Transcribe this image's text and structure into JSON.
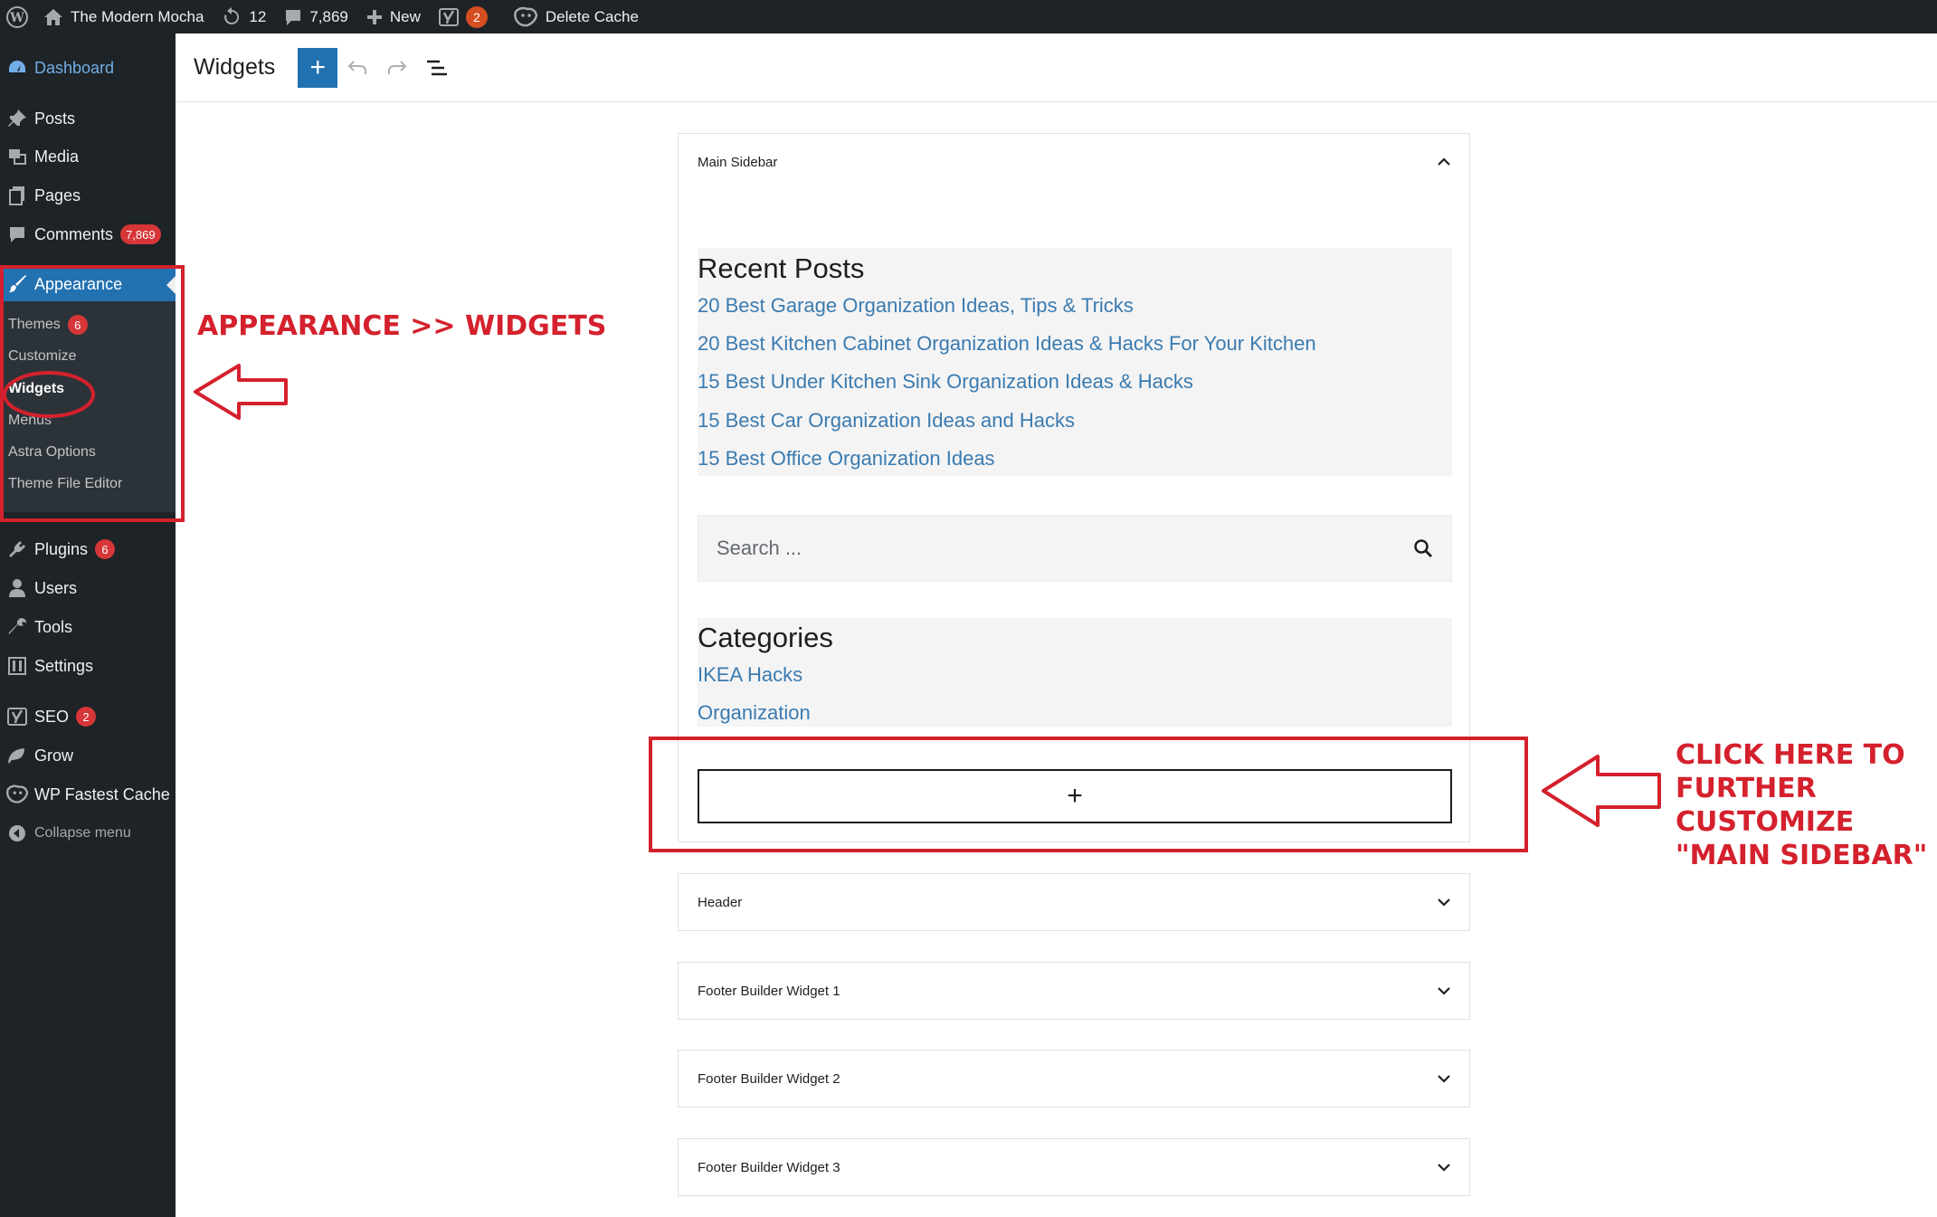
{
  "admin_bar": {
    "site_name": "The Modern Mocha",
    "updates_count": "12",
    "comments_count": "7,869",
    "new_label": "New",
    "yoast_badge": "2",
    "delete_cache_label": "Delete Cache"
  },
  "menu": {
    "dashboard": "Dashboard",
    "posts": "Posts",
    "media": "Media",
    "pages": "Pages",
    "comments": "Comments",
    "comments_badge": "7,869",
    "appearance": "Appearance",
    "plugins": "Plugins",
    "plugins_badge": "6",
    "users": "Users",
    "tools": "Tools",
    "settings": "Settings",
    "seo": "SEO",
    "seo_badge": "2",
    "grow": "Grow",
    "wp_fastest_cache": "WP Fastest Cache",
    "collapse": "Collapse menu",
    "appearance_sub": {
      "themes": "Themes",
      "themes_badge": "6",
      "customize": "Customize",
      "widgets": "Widgets",
      "menus": "Menus",
      "astra_options": "Astra Options",
      "theme_file_editor": "Theme File Editor"
    }
  },
  "editor": {
    "title": "Widgets",
    "add_block_symbol": "+"
  },
  "main_sidebar": {
    "title": "Main Sidebar",
    "recent_posts": {
      "heading": "Recent Posts",
      "items": [
        "20 Best Garage Organization Ideas, Tips & Tricks",
        "20 Best Kitchen Cabinet Organization Ideas & Hacks For Your Kitchen",
        "15 Best Under Kitchen Sink Organization Ideas & Hacks",
        "15 Best Car Organization Ideas and Hacks",
        "15 Best Office Organization Ideas"
      ]
    },
    "search_placeholder": "Search ...",
    "categories": {
      "heading": "Categories",
      "items": [
        "IKEA Hacks",
        "Organization"
      ]
    },
    "appender_symbol": "+"
  },
  "widget_areas": [
    "Header",
    "Footer Builder Widget 1",
    "Footer Builder Widget 2",
    "Footer Builder Widget 3"
  ],
  "annotations": {
    "appearance_note": "APPEARANCE >> WIDGETS",
    "click_note_lines": [
      "CLICK HERE TO",
      "FURTHER",
      "CUSTOMIZE",
      "\"MAIN SIDEBAR\""
    ],
    "color": "#d4212d"
  },
  "colors": {
    "admin_dark": "#1d2327",
    "accent_blue": "#2271b1",
    "link_blue": "#3a7bb0",
    "badge_red": "#d63638"
  }
}
